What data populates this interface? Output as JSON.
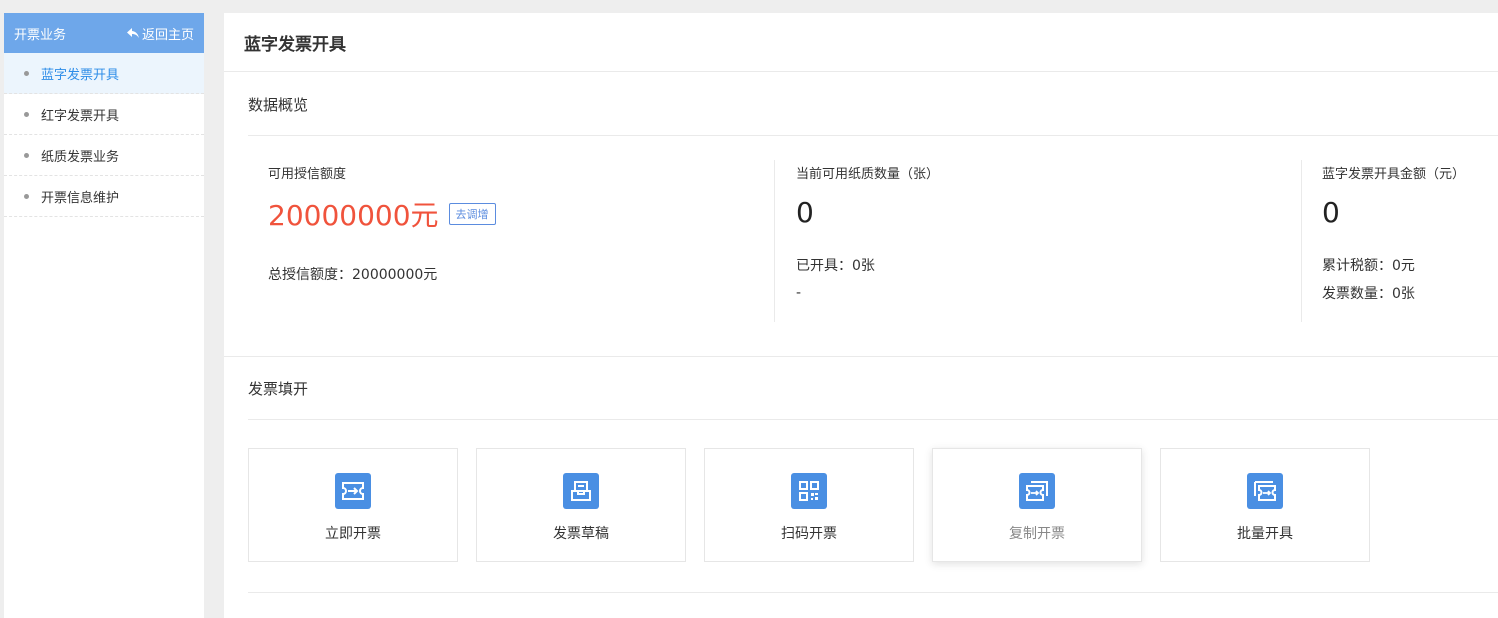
{
  "sidebar": {
    "title": "开票业务",
    "back_label": "返回主页",
    "items": [
      {
        "label": "蓝字发票开具"
      },
      {
        "label": "红字发票开具"
      },
      {
        "label": "纸质发票业务"
      },
      {
        "label": "开票信息维护"
      }
    ]
  },
  "page": {
    "title": "蓝字发票开具"
  },
  "overview": {
    "title": "数据概览",
    "credit": {
      "label": "可用授信额度",
      "amount": "20000000元",
      "adjust_label": "去调增",
      "total": "总授信额度：20000000元"
    },
    "paper": {
      "label": "当前可用纸质数量（张）",
      "value": "0",
      "issued": "已开具：0张",
      "extra": "-"
    },
    "amount": {
      "label": "蓝字发票开具金额（元）",
      "value": "0",
      "tax": "累计税额：0元",
      "count": "发票数量：0张"
    }
  },
  "fill": {
    "title": "发票填开",
    "cards": [
      {
        "label": "立即开票",
        "icon": "invoice-arrow-icon"
      },
      {
        "label": "发票草稿",
        "icon": "draft-icon"
      },
      {
        "label": "扫码开票",
        "icon": "qr-code-icon"
      },
      {
        "label": "复制开票",
        "icon": "copy-invoice-icon"
      },
      {
        "label": "批量开具",
        "icon": "batch-invoice-icon"
      }
    ]
  },
  "colors": {
    "sidebar_header": "#6ea7ea",
    "active_item_bg": "#ecf5fd",
    "active_item_text": "#2e8de8",
    "credit_amount": "#f0533c",
    "icon_bg": "#4a8fe3",
    "adjust_button": "#5b8cdf"
  }
}
